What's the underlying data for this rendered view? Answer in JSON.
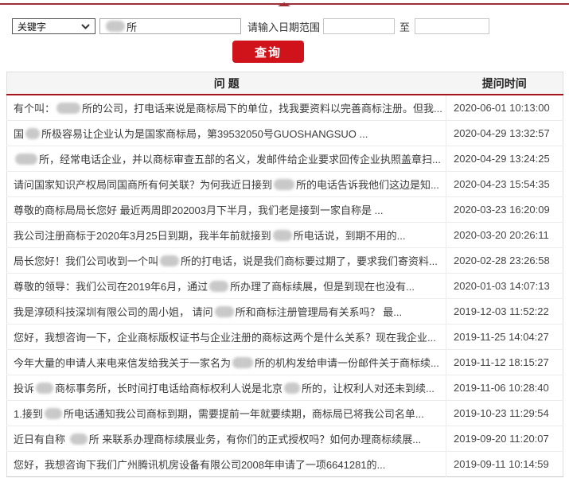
{
  "accent": {
    "top_line": "#a03038",
    "button_red": "#d0121a",
    "header_underline": "#a6141c"
  },
  "search": {
    "keyword_select_value": "关键字",
    "keyword_input_suffix": "所",
    "date_range_label": "请输入日期范围",
    "to_label": "至",
    "date_from_value": "",
    "date_to_value": "",
    "submit_label": "查询"
  },
  "table": {
    "headers": {
      "question": "问 题",
      "time": "提问时间"
    },
    "rows": [
      {
        "parts": [
          {
            "t": "有个叫："
          },
          {
            "b": 30
          },
          {
            "t": "所的公司，打电话来说是商标局下的单位，找我要资料以完善商标注册。但我..."
          }
        ],
        "time": "2020-06-01 10:13:00"
      },
      {
        "parts": [
          {
            "t": "国"
          },
          {
            "b": 18
          },
          {
            "t": "所极容易让企业认为是国家商标局，第39532050号GUOSHANGSUO ..."
          }
        ],
        "time": "2020-04-29 13:32:57"
      },
      {
        "parts": [
          {
            "b": 28
          },
          {
            "t": "所，经常电话企业，并以商标审查五部的名义，发邮件给企业要求回传企业执照盖章扫..."
          }
        ],
        "time": "2020-04-29 13:24:25"
      },
      {
        "parts": [
          {
            "t": "请问国家知识产权局同国商所有何关联？为何我近日接到"
          },
          {
            "b": 26
          },
          {
            "t": "所的电话告诉我他们这边是知..."
          }
        ],
        "time": "2020-04-23 15:54:35"
      },
      {
        "parts": [
          {
            "t": "尊敬的商标局局长您好 最近两周即202003月下半月，我们老是接到一家自称是 ..."
          }
        ],
        "time": "2020-03-23 16:20:09"
      },
      {
        "parts": [
          {
            "t": "我公司注册商标于2020年3月25日到期，我半年前就接到"
          },
          {
            "b": 24
          },
          {
            "t": "所电话说，到期不用的..."
          }
        ],
        "time": "2020-03-20 20:26:11"
      },
      {
        "parts": [
          {
            "t": "局长您好！我们公司收到一个叫"
          },
          {
            "b": 24
          },
          {
            "t": "所的打电话，说是我们商标要过期了，要求我们寄资料..."
          }
        ],
        "time": "2020-02-28 23:26:58"
      },
      {
        "parts": [
          {
            "t": "尊敬的领导：我们公司在2019年6月，通过"
          },
          {
            "b": 24
          },
          {
            "t": "所办理了商标续展，但是到现在也没有..."
          }
        ],
        "time": "2020-01-03 14:07:13"
      },
      {
        "parts": [
          {
            "t": "我是淳硕科技深圳有限公司的周小姐， 请问"
          },
          {
            "b": 24
          },
          {
            "t": "所和商标注册管理局有关系吗？ 最..."
          }
        ],
        "time": "2019-12-03 11:52:22"
      },
      {
        "parts": [
          {
            "t": "您好，我想咨询一下，企业商标版权证书与企业注册的商标这两个是什么关系？现在我企业..."
          }
        ],
        "time": "2019-11-25 14:04:27"
      },
      {
        "parts": [
          {
            "t": "今年大量的申请人来电来信发给我关于一家名为"
          },
          {
            "b": 26
          },
          {
            "t": "所的机构发给申请一份邮件关于商标续..."
          }
        ],
        "time": "2019-11-12 18:15:27"
      },
      {
        "parts": [
          {
            "t": "投诉"
          },
          {
            "b": 22
          },
          {
            "t": "商标事务所，长时间打电话给商标权利人说是北京"
          },
          {
            "b": 20
          },
          {
            "t": "所的，让权利人对还未到续..."
          }
        ],
        "time": "2019-11-06 10:28:40"
      },
      {
        "parts": [
          {
            "t": "1.接到"
          },
          {
            "b": 22
          },
          {
            "t": "所电话通知我公司商标到期，需要提前一年就要续期，商标局已将我公司名单..."
          }
        ],
        "time": "2019-10-23 11:29:54"
      },
      {
        "parts": [
          {
            "t": "近日有自称 "
          },
          {
            "b": 22
          },
          {
            "t": "所 来联系办理商标续展业务，有你们的正式授权吗？如何办理商标续展..."
          }
        ],
        "time": "2019-09-20 11:20:07"
      },
      {
        "parts": [
          {
            "t": "您好，我想咨询下我们广州腾讯机房设备有限公司2008年申请了一项6641281的..."
          }
        ],
        "time": "2019-09-11 10:14:59"
      }
    ]
  }
}
